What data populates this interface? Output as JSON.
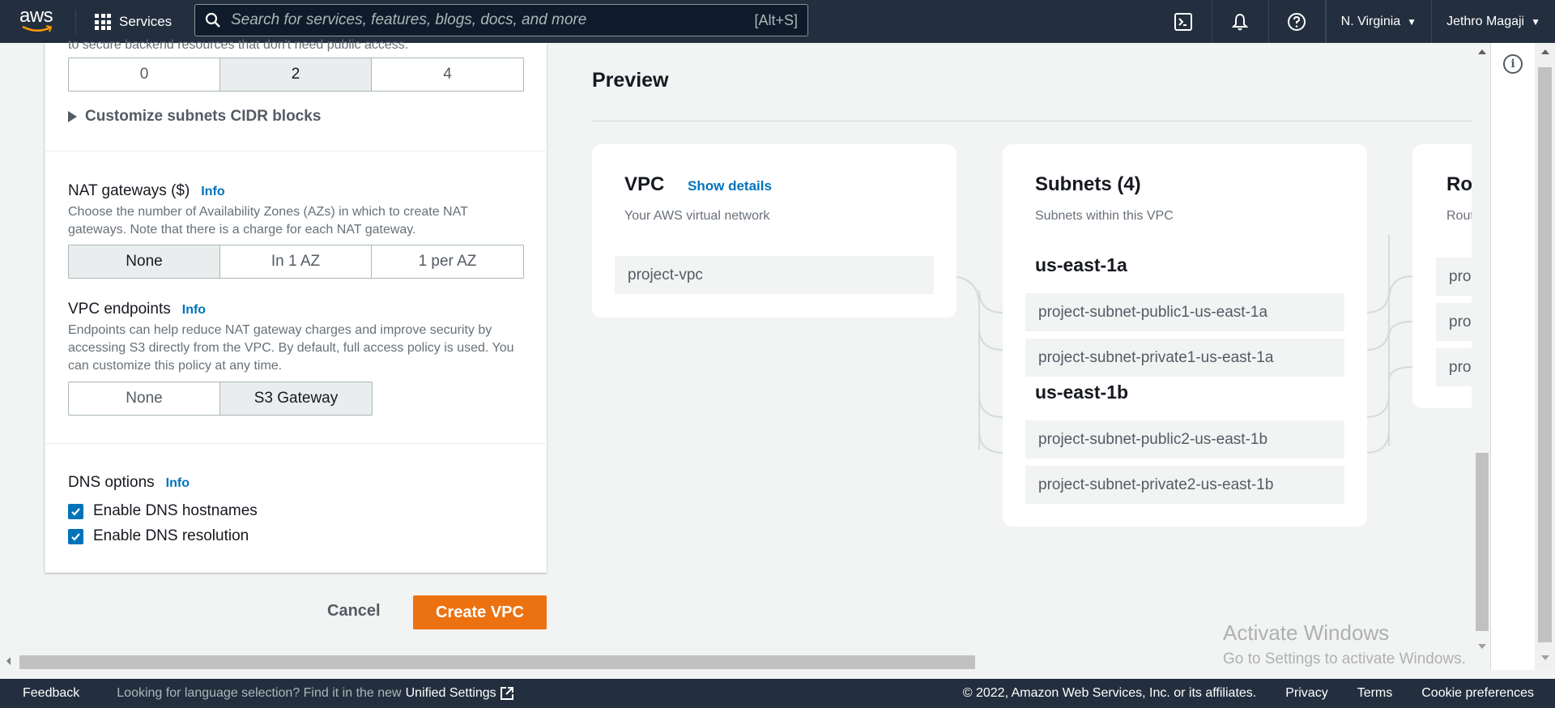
{
  "nav": {
    "logo_text": "aws",
    "services_label": "Services",
    "search_placeholder": "Search for services, features, blogs, docs, and more",
    "search_value": "",
    "search_shortcut": "[Alt+S]",
    "region": "N. Virginia",
    "user": "Jethro Magaji",
    "icons": [
      "cloudshell-icon",
      "bell-icon",
      "help-icon"
    ]
  },
  "form": {
    "cut_off_text": "to secure backend resources that don't need public access.",
    "private_subnets": {
      "options": [
        "0",
        "2",
        "4"
      ],
      "selected": "2"
    },
    "customize_cidr_label": "Customize subnets CIDR blocks",
    "nat_gateways": {
      "label": "NAT gateways ($)",
      "info": "Info",
      "description": "Choose the number of Availability Zones (AZs) in which to create NAT gateways. Note that there is a charge for each NAT gateway.",
      "options": [
        "None",
        "In 1 AZ",
        "1 per AZ"
      ],
      "selected": "None"
    },
    "vpc_endpoints": {
      "label": "VPC endpoints",
      "info": "Info",
      "description": "Endpoints can help reduce NAT gateway charges and improve security by accessing S3 directly from the VPC. By default, full access policy is used. You can customize this policy at any time.",
      "options": [
        "None",
        "S3 Gateway"
      ],
      "selected": "S3 Gateway"
    },
    "dns_options": {
      "label": "DNS options",
      "info": "Info",
      "checkboxes": [
        {
          "label": "Enable DNS hostnames",
          "checked": true
        },
        {
          "label": "Enable DNS resolution",
          "checked": true
        }
      ]
    },
    "cancel_label": "Cancel",
    "create_label": "Create VPC"
  },
  "preview": {
    "title": "Preview",
    "vpc": {
      "title": "VPC",
      "show_details": "Show details",
      "subtitle": "Your AWS virtual network",
      "items": [
        "project-vpc"
      ]
    },
    "subnets": {
      "title": "Subnets (4)",
      "subtitle": "Subnets within this VPC",
      "zones": [
        {
          "name": "us-east-1a",
          "items": [
            "project-subnet-public1-us-east-1a",
            "project-subnet-private1-us-east-1a"
          ]
        },
        {
          "name": "us-east-1b",
          "items": [
            "project-subnet-public2-us-east-1b",
            "project-subnet-private2-us-east-1b"
          ]
        }
      ]
    },
    "route_tables": {
      "title": "Ro",
      "subtitle": "Rout",
      "items": [
        "pro",
        "pro",
        "pro"
      ]
    }
  },
  "watermark": {
    "line1": "Activate Windows",
    "line2": "Go to Settings to activate Windows."
  },
  "footer": {
    "feedback": "Feedback",
    "language_text": "Looking for language selection? Find it in the new",
    "unified_settings": "Unified Settings",
    "copyright": "© 2022, Amazon Web Services, Inc. or its affiliates.",
    "privacy": "Privacy",
    "terms": "Terms",
    "cookie_preferences": "Cookie preferences"
  },
  "colors": {
    "nav_bg": "#232f3e",
    "primary_button": "#ec7211",
    "link": "#0073bb",
    "checkbox": "#0073bb"
  }
}
